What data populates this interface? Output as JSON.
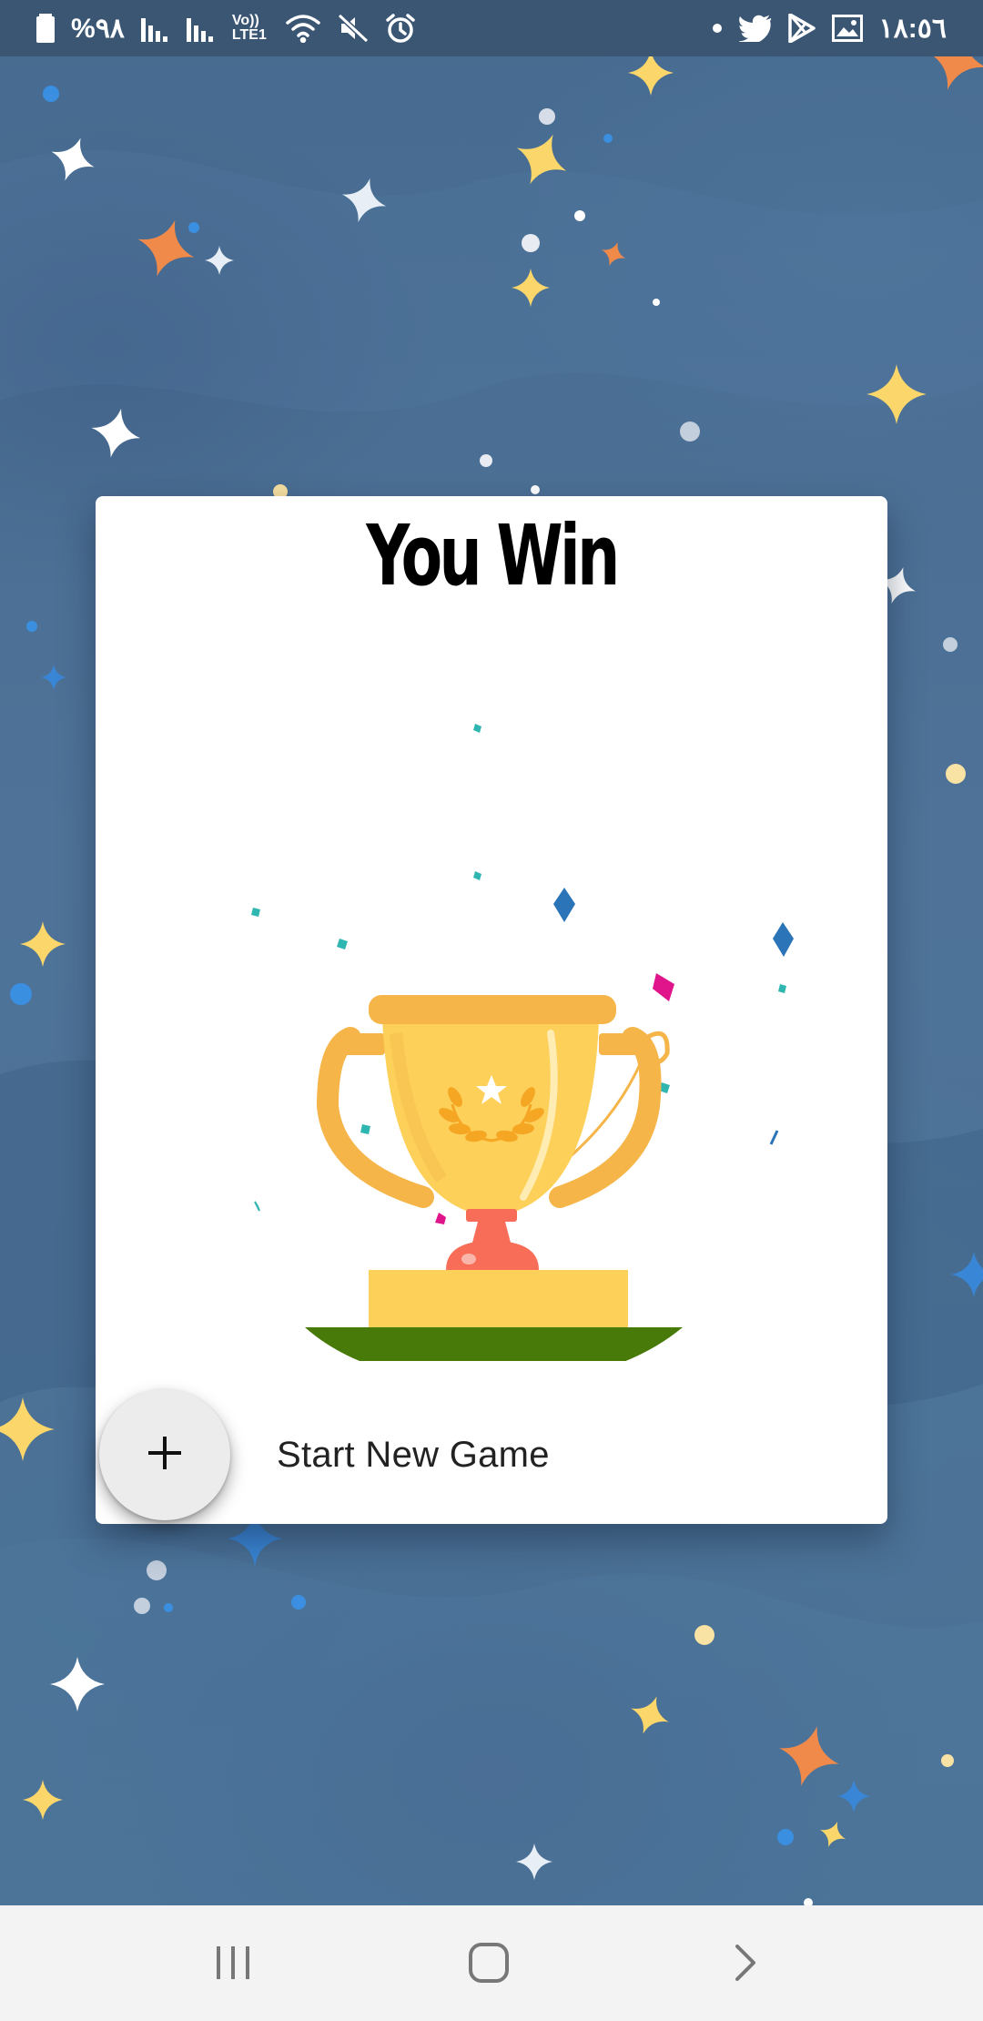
{
  "status_bar": {
    "battery": "%٩٨",
    "network": "Vo)) LTE1",
    "time": "١٨:٥٦",
    "icons": [
      "battery-icon",
      "signal-icon",
      "signal-icon",
      "volte-icon",
      "wifi-icon",
      "mute-icon",
      "alarm-icon",
      "dot-icon",
      "twitter-icon",
      "play-store-icon",
      "gallery-icon"
    ]
  },
  "dialog": {
    "title": "You Win",
    "illustration": "trophy-icon",
    "fab_icon": "plus-icon",
    "action_label": "Start New Game"
  },
  "nav_bar": {
    "icons": [
      "recents-icon",
      "home-icon",
      "back-icon"
    ]
  },
  "colors": {
    "background": "#4d6f94",
    "status_bar": "#3b5673",
    "card": "#ffffff",
    "trophy_gold": "#fdd05a",
    "trophy_dark_gold": "#f5b549",
    "grass": "#477a08",
    "stem": "#f76d58"
  }
}
